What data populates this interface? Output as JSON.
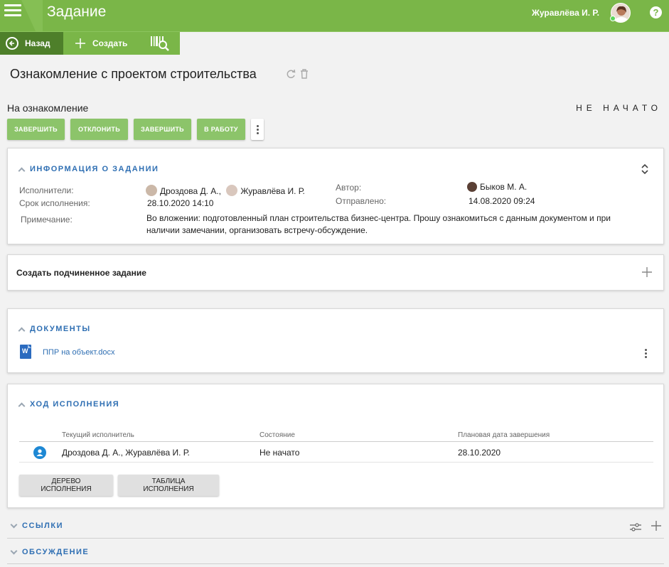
{
  "app": {
    "title": "Задание",
    "user_name": "Журавлёва И. Р.",
    "help_label": "?"
  },
  "toolbar": {
    "back_label": "Назад",
    "create_label": "Создать"
  },
  "task": {
    "title": "Ознакомление с проектом строительства",
    "stage": "На ознакомление",
    "status": "НЕ НАЧАТО"
  },
  "actions": [
    "ЗАВЕРШИТЬ",
    "ОТКЛОНИТЬ",
    "ЗАВЕРШИТЬ",
    "В РАБОТУ"
  ],
  "info": {
    "title": "ИНФОРМАЦИЯ О ЗАДАНИИ",
    "executors_label": "Исполнители:",
    "executor_1": "Дроздова Д. А.,",
    "executor_2": "Журавлёва И. Р.",
    "deadline_label": "Срок исполнения:",
    "deadline_value": "28.10.2020 14:10",
    "author_label": "Автор:",
    "author_value": "Быков М. А.",
    "sent_label": "Отправлено:",
    "sent_value": "14.08.2020 09:24",
    "note_label": "Примечание:",
    "note_line1": "Во вложении: подготовленный план строительства бизнес-центра. Прошу ознакомиться с данным документом и при",
    "note_line2": "наличии замечании, организовать встречу-обсуждение."
  },
  "subtask": {
    "label": "Создать подчиненное задание"
  },
  "documents": {
    "title": "ДОКУМЕНТЫ",
    "file_name": "ППР на объект.docx",
    "file_icon": "W"
  },
  "progress": {
    "title": "ХОД ИСПОЛНЕНИЯ",
    "columns": [
      "Текущий исполнитель",
      "Состояние",
      "Плановая дата завершения"
    ],
    "row": {
      "executor": "Дроздова Д. А., Журавлёва И. Р.",
      "state": "Не начато",
      "date": "28.10.2020"
    },
    "tree_button": "ДЕРЕВО ИСПОЛНЕНИЯ",
    "table_button": "ТАБЛИЦА ИСПОЛНЕНИЯ"
  },
  "links": {
    "title": "ССЫЛКИ"
  },
  "discussion": {
    "title": "ОБСУЖДЕНИЕ"
  },
  "colors": {
    "brand_green": "#7ab648",
    "dark_green": "#4e7f2a",
    "button_green": "#8cc46a",
    "link_blue": "#2f6fb3"
  }
}
